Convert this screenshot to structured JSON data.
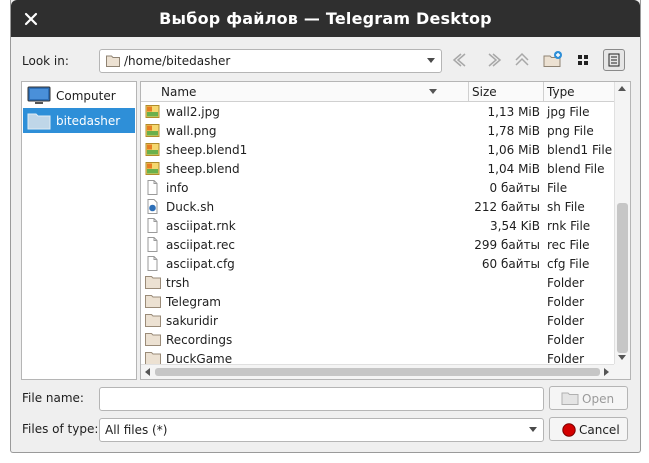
{
  "window": {
    "title": "Выбор файлов — Telegram Desktop"
  },
  "toolbar": {
    "look_in_label": "Look in:",
    "path": "/home/bitedasher",
    "buttons": [
      "back-icon",
      "forward-icon",
      "parent-directory-icon",
      "new-folder-icon",
      "list-view-icon",
      "detail-view-icon"
    ]
  },
  "sidebar": {
    "items": [
      {
        "label": "Computer",
        "icon": "computer-icon"
      },
      {
        "label": "bitedasher",
        "icon": "folder-icon",
        "selected": true
      }
    ]
  },
  "file_list": {
    "columns": [
      "Name",
      "Size",
      "Type"
    ],
    "rows": [
      {
        "name": "wall2.jpg",
        "size": "1,13 MiB",
        "type": "jpg File",
        "icon": "image-file-icon"
      },
      {
        "name": "wall.png",
        "size": "1,78 MiB",
        "type": "png File",
        "icon": "image-file-icon"
      },
      {
        "name": "sheep.blend1",
        "size": "1,06 MiB",
        "type": "blend1 File",
        "icon": "image-file-icon"
      },
      {
        "name": "sheep.blend",
        "size": "1,04 MiB",
        "type": "blend File",
        "icon": "image-file-icon"
      },
      {
        "name": "info",
        "size": "0 байты",
        "type": "File",
        "icon": "file-icon"
      },
      {
        "name": "Duck.sh",
        "size": "212 байты",
        "type": "sh File",
        "icon": "script-file-icon"
      },
      {
        "name": "asciipat.rnk",
        "size": "3,54 KiB",
        "type": "rnk File",
        "icon": "file-icon"
      },
      {
        "name": "asciipat.rec",
        "size": "299 байты",
        "type": "rec File",
        "icon": "file-icon"
      },
      {
        "name": "asciipat.cfg",
        "size": "60 байты",
        "type": "cfg File",
        "icon": "file-icon"
      },
      {
        "name": "trsh",
        "size": "",
        "type": "Folder",
        "icon": "folder-icon"
      },
      {
        "name": "Telegram",
        "size": "",
        "type": "Folder",
        "icon": "folder-icon"
      },
      {
        "name": "sakuridir",
        "size": "",
        "type": "Folder",
        "icon": "folder-icon"
      },
      {
        "name": "Recordings",
        "size": "",
        "type": "Folder",
        "icon": "folder-icon"
      },
      {
        "name": "DuckGame",
        "size": "",
        "type": "Folder",
        "icon": "folder-icon"
      }
    ]
  },
  "form": {
    "file_name_label": "File name:",
    "file_name_value": "",
    "file_type_label": "Files of type:",
    "file_type_value": "All files (*)",
    "open_label": "Open",
    "cancel_label": "Cancel"
  },
  "colors": {
    "titlebar": "#2f2f2f",
    "selection": "#2e8fd8",
    "folder": "#ece1d2",
    "cancel_icon": "#d40000"
  }
}
